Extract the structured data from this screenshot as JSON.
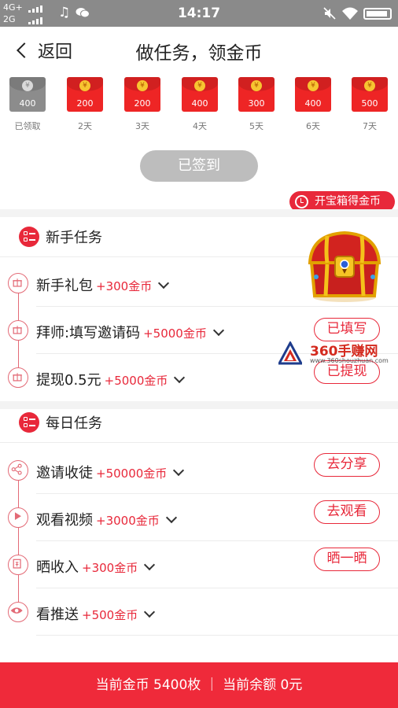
{
  "status_bar": {
    "net_top": "4G+",
    "net_bottom": "2G",
    "time": "14:17"
  },
  "header": {
    "back_label": "返回",
    "title": "做任务，领金币"
  },
  "checkin": {
    "days": [
      {
        "amount": "400",
        "label": "已领取",
        "claimed": true
      },
      {
        "amount": "200",
        "label": "2天",
        "claimed": false
      },
      {
        "amount": "200",
        "label": "3天",
        "claimed": false
      },
      {
        "amount": "400",
        "label": "4天",
        "claimed": false
      },
      {
        "amount": "300",
        "label": "5天",
        "claimed": false
      },
      {
        "amount": "400",
        "label": "6天",
        "claimed": false
      },
      {
        "amount": "500",
        "label": "7天",
        "claimed": false
      }
    ],
    "coin_symbol": "¥",
    "signed_label": "已签到"
  },
  "treasure": {
    "label": "开宝箱得金币"
  },
  "newbie": {
    "title": "新手任务",
    "tasks": [
      {
        "name": "新手礼包",
        "reward": "+300金币",
        "button": ""
      },
      {
        "name": "拜师:填写邀请码",
        "reward": "+5000金币",
        "button": "已填写"
      },
      {
        "name": "提现0.5元",
        "reward": "+5000金币",
        "button": "已提现"
      }
    ]
  },
  "daily": {
    "title": "每日任务",
    "tasks": [
      {
        "name": "邀请收徒",
        "reward": "+50000金币",
        "button": "去分享"
      },
      {
        "name": "观看视频",
        "reward": "+3000金币",
        "button": "去观看"
      },
      {
        "name": "晒收入",
        "reward": "+300金币",
        "button": "晒一晒"
      },
      {
        "name": "看推送",
        "reward": "+500金币",
        "button": ""
      }
    ]
  },
  "watermark": {
    "title": "360手赚网",
    "url": "www.360shouzhuan.com"
  },
  "footer": {
    "text": "当前金币 5400枚 ｜ 当前余额 0元"
  },
  "colors": {
    "accent": "#e8283a",
    "packet_red": "#ee2525",
    "claimed_gray": "#8c8c8c",
    "status_bar": "#8a8a8a"
  }
}
